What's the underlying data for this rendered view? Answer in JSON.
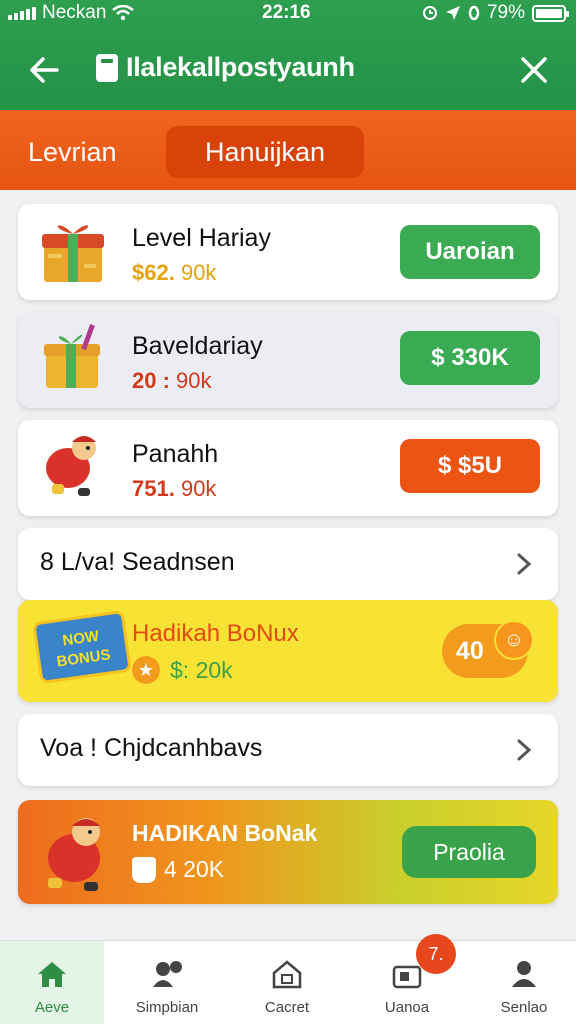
{
  "status_bar": {
    "carrier": "Neckan",
    "time": "22:16",
    "battery": "79%"
  },
  "header": {
    "title": "Ilalekallpostyaunh"
  },
  "tabs": [
    {
      "label": "Levrian",
      "active": false
    },
    {
      "label": "Hanuijkan",
      "active": true
    }
  ],
  "items": [
    {
      "name": "Level Hariay",
      "price_a": "$62.",
      "price_b": "90k",
      "price_a_color": "#e8a30a",
      "button": "Uaroian",
      "button_style": "green",
      "icon": "gift-box-icon"
    },
    {
      "name": "Baveldariay",
      "price_a": "20 :",
      "price_b": "90k",
      "price_a_color": "#d33a1c",
      "button": "$ 330K",
      "button_style": "green",
      "icon": "gift-drink-icon"
    },
    {
      "name": "Panahh",
      "price_a": "751.",
      "price_b": "90k",
      "price_a_color": "#d33a1c",
      "button": "$ $5U",
      "button_style": "orange",
      "icon": "character-icon"
    }
  ],
  "section1": {
    "label": "8 L/va! Seadnsen"
  },
  "bonus1": {
    "badge": "NOW BONUS",
    "title": "Hadikah BoNux",
    "sub": "$: 20k",
    "count": "40"
  },
  "section2": {
    "label": "Voa ! Chjdcanhbavs"
  },
  "bonus2": {
    "title": "HADIKAN BoNak",
    "sub": "4 20K",
    "button": "Praolia"
  },
  "bottom_nav": [
    {
      "label": "Aeve",
      "icon": "home-icon",
      "active": true
    },
    {
      "label": "Simpbian",
      "icon": "person-chat-icon",
      "active": false
    },
    {
      "label": "Cacret",
      "icon": "house-outline-icon",
      "active": false
    },
    {
      "label": "Uanoa",
      "icon": "inbox-icon",
      "active": false
    },
    {
      "label": "Senlao",
      "icon": "user-icon",
      "active": false
    }
  ],
  "notification_count": "7.",
  "colors": {
    "header_green": "#249247",
    "tab_orange": "#e65512",
    "button_green": "#3bab53",
    "button_orange": "#ec5414",
    "bonus_yellow": "#f8e233"
  }
}
